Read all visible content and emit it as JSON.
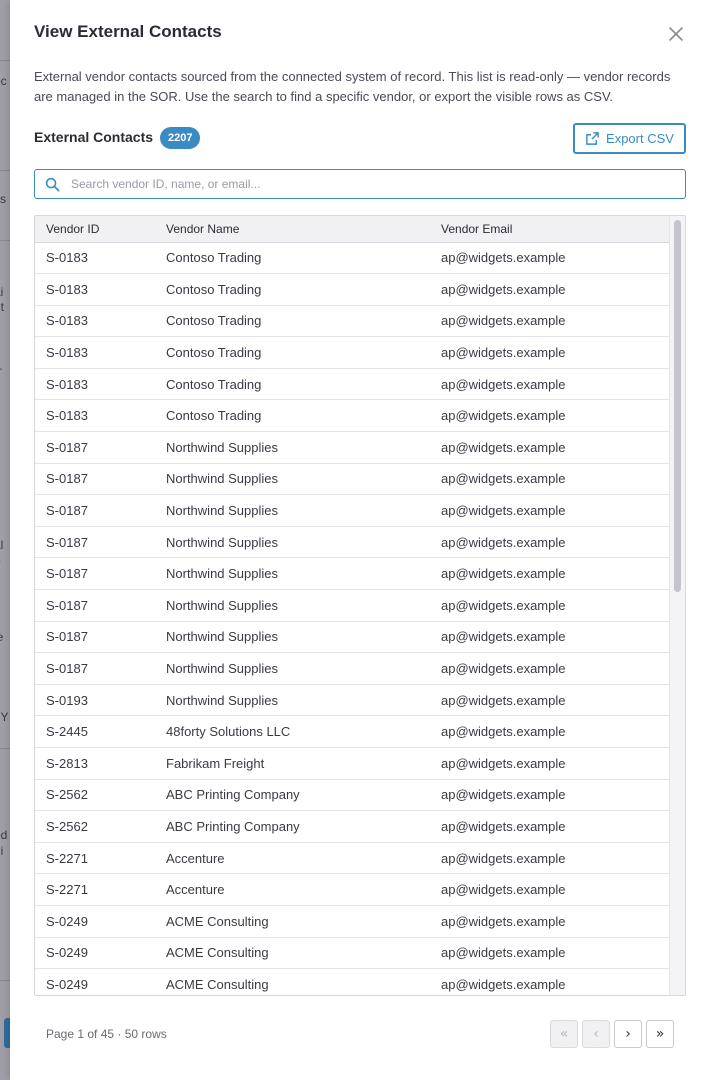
{
  "modal": {
    "title": "View External Contacts",
    "description": "External vendor contacts sourced from the connected system of record. This list is read-only — vendor records are managed in the SOR. Use the search to find a specific vendor, or export the visible rows as CSV.",
    "section_title": "External Contacts",
    "count_badge": "2207",
    "export_label": "Export CSV"
  },
  "search": {
    "placeholder": "Search vendor ID, name, or email...",
    "value": ""
  },
  "table": {
    "columns": [
      "Vendor ID",
      "Vendor Name",
      "Vendor Email"
    ],
    "rows": [
      [
        "S-0183",
        "Contoso Trading",
        "ap@widgets.example"
      ],
      [
        "S-0183",
        "Contoso Trading",
        "ap@widgets.example"
      ],
      [
        "S-0183",
        "Contoso Trading",
        "ap@widgets.example"
      ],
      [
        "S-0183",
        "Contoso Trading",
        "ap@widgets.example"
      ],
      [
        "S-0183",
        "Contoso Trading",
        "ap@widgets.example"
      ],
      [
        "S-0183",
        "Contoso Trading",
        "ap@widgets.example"
      ],
      [
        "S-0187",
        "Northwind Supplies",
        "ap@widgets.example"
      ],
      [
        "S-0187",
        "Northwind Supplies",
        "ap@widgets.example"
      ],
      [
        "S-0187",
        "Northwind Supplies",
        "ap@widgets.example"
      ],
      [
        "S-0187",
        "Northwind Supplies",
        "ap@widgets.example"
      ],
      [
        "S-0187",
        "Northwind Supplies",
        "ap@widgets.example"
      ],
      [
        "S-0187",
        "Northwind Supplies",
        "ap@widgets.example"
      ],
      [
        "S-0187",
        "Northwind Supplies",
        "ap@widgets.example"
      ],
      [
        "S-0187",
        "Northwind Supplies",
        "ap@widgets.example"
      ],
      [
        "S-0193",
        "Northwind Supplies",
        "ap@widgets.example"
      ],
      [
        "S-2445",
        "48forty Solutions LLC",
        "ap@widgets.example"
      ],
      [
        "S-2813",
        "Fabrikam Freight",
        "ap@widgets.example"
      ],
      [
        "S-2562",
        "ABC Printing Company",
        "ap@widgets.example"
      ],
      [
        "S-2562",
        "ABC Printing Company",
        "ap@widgets.example"
      ],
      [
        "S-2271",
        "Accenture",
        "ap@widgets.example"
      ],
      [
        "S-2271",
        "Accenture",
        "ap@widgets.example"
      ],
      [
        "S-0249",
        "ACME Consulting",
        "ap@widgets.example"
      ],
      [
        "S-0249",
        "ACME Consulting",
        "ap@widgets.example"
      ],
      [
        "S-0249",
        "ACME Consulting",
        "ap@widgets.example"
      ]
    ]
  },
  "pagination": {
    "info": "Page 1 of 45 · 50 rows",
    "first": "«",
    "prev": "‹",
    "next": "›",
    "last": "»"
  },
  "colors": {
    "accent": "#3a8bc4",
    "title_text": "#2b2b36",
    "backdrop": "#8e8a94"
  },
  "icons": [
    "close-icon",
    "export-icon",
    "search-icon"
  ]
}
